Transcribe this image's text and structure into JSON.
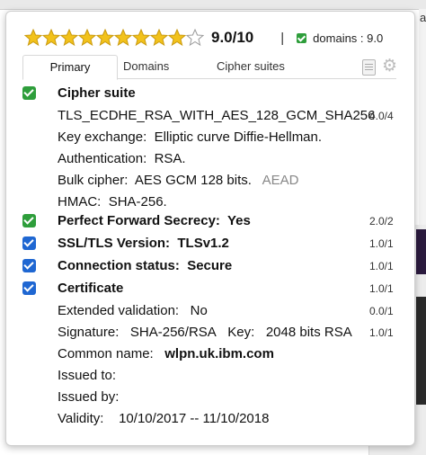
{
  "background": {
    "corner_text": "ai"
  },
  "header": {
    "rating_stars": 9,
    "rating_max": 10,
    "score_text": "9.0/10",
    "separator": "|",
    "domains_text": "domains : 9.0"
  },
  "tabs": {
    "primary": "Primary",
    "domains": "Domains",
    "cipher_suites": "Cipher suites"
  },
  "cipher_suite": {
    "title": "Cipher suite",
    "name": "TLS_ECDHE_RSA_WITH_AES_128_GCM_SHA256",
    "name_score": "4.0/4",
    "key_exchange_label": "Key exchange:",
    "key_exchange_value": "Elliptic curve Diffie-Hellman.",
    "authentication_label": "Authentication:",
    "authentication_value": "RSA.",
    "bulk_cipher_label": "Bulk cipher:",
    "bulk_cipher_value": "AES GCM 128 bits.",
    "bulk_cipher_note": "AEAD",
    "hmac_label": "HMAC:",
    "hmac_value": "SHA-256."
  },
  "pfs": {
    "label": "Perfect Forward Secrecy:",
    "value": "Yes",
    "score": "2.0/2"
  },
  "ssl_tls": {
    "label": "SSL/TLS Version:",
    "value": "TLSv1.2",
    "score": "1.0/1"
  },
  "connection": {
    "label": "Connection status:",
    "value": "Secure",
    "score": "1.0/1"
  },
  "certificate": {
    "title": "Certificate",
    "score": "1.0/1",
    "extended_label": "Extended validation:",
    "extended_value": "No",
    "extended_score": "0.0/1",
    "signature_label": "Signature:",
    "signature_value": "SHA-256/RSA",
    "key_label": "Key:",
    "key_value": "2048 bits RSA",
    "signature_score": "1.0/1",
    "common_name_label": "Common name:",
    "common_name_value": "wlpn.uk.ibm.com",
    "issued_to_label": "Issued to:",
    "issued_by_label": "Issued by:",
    "validity_label": "Validity:",
    "validity_value": "10/10/2017 -- 11/10/2018"
  },
  "colors": {
    "check_green": "#2e9e3b",
    "check_blue": "#1f67d2",
    "star_gold": "#f2c21b"
  },
  "icons": {
    "notes": "notes-icon",
    "settings": "gear-icon"
  }
}
